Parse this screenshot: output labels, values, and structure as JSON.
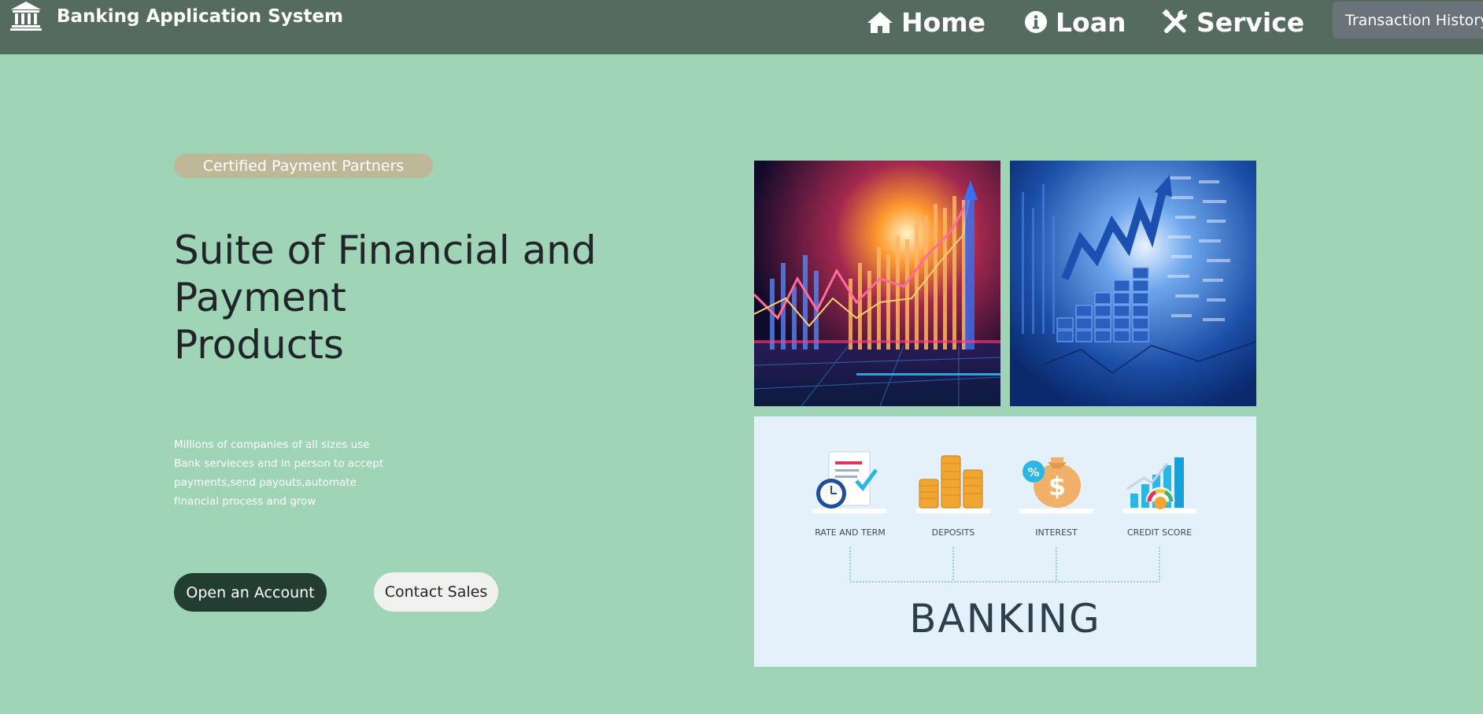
{
  "navbar": {
    "brand": "Banking Application System",
    "brand_icon": "bank-icon",
    "links": [
      {
        "label": "Home",
        "icon": "home-icon"
      },
      {
        "label": "Loan",
        "icon": "info-icon"
      },
      {
        "label": "Service",
        "icon": "tools-icon"
      }
    ],
    "history_button": "Transaction History"
  },
  "hero": {
    "badge": "Certified Payment Partners",
    "title_lines": [
      "Suite of Financial and",
      "Payment",
      "Products"
    ],
    "description_lines": [
      "Millions of companies of all sizes use",
      "Bank servieces and in person to accept",
      "payments,send payouts,automate",
      "financial process and grow"
    ],
    "primary_button": "Open an Account",
    "secondary_button": "Contact Sales"
  },
  "banking_graphic": {
    "items": [
      "RATE AND TERM",
      "DEPOSITS",
      "INTEREST",
      "CREDIT SCORE"
    ],
    "title": "BANKING"
  },
  "colors": {
    "page_background": "#9fd4b7",
    "navbar": "#556b5f",
    "badge": "#bfb898",
    "primary_button": "#243d33",
    "secondary_button": "#f0f0ef",
    "history_button": "#6a727a"
  }
}
